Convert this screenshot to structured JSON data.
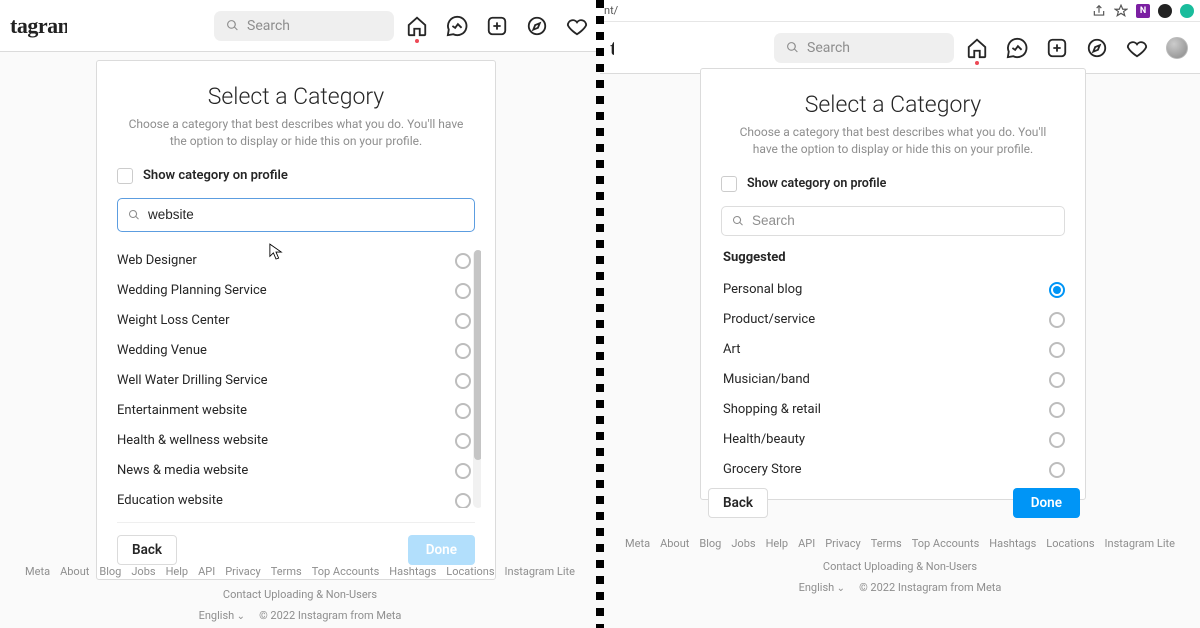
{
  "brand": "tagram",
  "search_placeholder": "Search",
  "browser": {
    "address": "nt/"
  },
  "card": {
    "title": "Select a Category",
    "subtitle": "Choose a category that best describes what you do. You'll have the option to display or hide this on your profile.",
    "show_label": "Show category on profile",
    "search_placeholder": "Search",
    "suggested_label": "Suggested",
    "back": "Back",
    "done": "Done"
  },
  "left": {
    "search_value": "website",
    "options": [
      "Web Designer",
      "Wedding Planning Service",
      "Weight Loss Center",
      "Wedding Venue",
      "Well Water Drilling Service",
      "Entertainment website",
      "Health & wellness website",
      "News & media website",
      "Education website"
    ]
  },
  "right": {
    "options": [
      "Personal blog",
      "Product/service",
      "Art",
      "Musician/band",
      "Shopping & retail",
      "Health/beauty",
      "Grocery Store"
    ],
    "selected_index": 0
  },
  "footer": {
    "links": [
      "Meta",
      "About",
      "Blog",
      "Jobs",
      "Help",
      "API",
      "Privacy",
      "Terms",
      "Top Accounts",
      "Hashtags",
      "Locations",
      "Instagram Lite",
      "Contact Uploading & Non-Users"
    ],
    "lang": "English",
    "copyright": "© 2022 Instagram from Meta"
  }
}
